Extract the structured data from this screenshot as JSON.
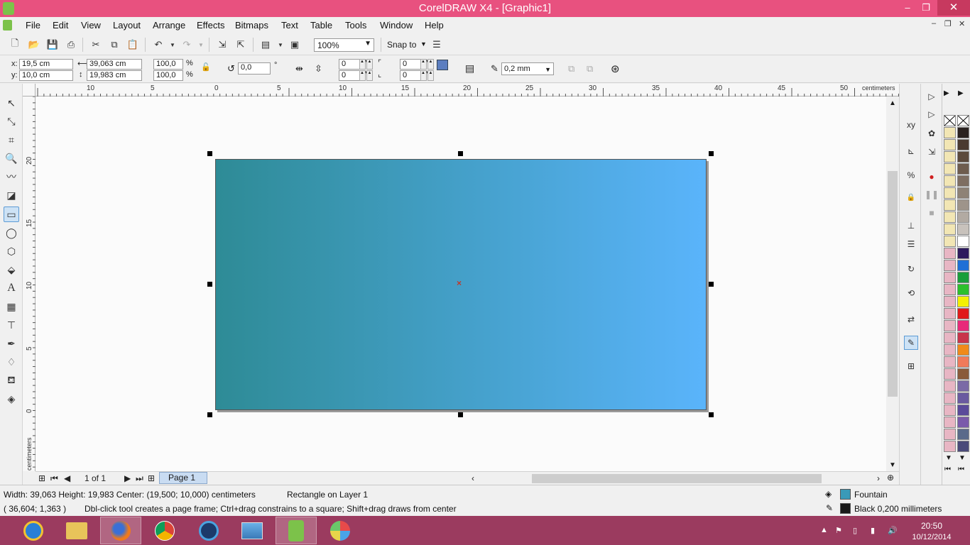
{
  "window": {
    "title": "CorelDRAW X4 - [Graphic1]",
    "minimize": "–",
    "restore": "❐",
    "close": "✕"
  },
  "menu": {
    "items": [
      "File",
      "Edit",
      "View",
      "Layout",
      "Arrange",
      "Effects",
      "Bitmaps",
      "Text",
      "Table",
      "Tools",
      "Window",
      "Help"
    ],
    "doc_controls": [
      "–",
      "❐",
      "✕"
    ]
  },
  "standard_toolbar": {
    "zoom_level": "100%",
    "snap_label": "Snap to"
  },
  "property_bar": {
    "x_label": "x:",
    "x_value": "19,5 cm",
    "y_label": "y:",
    "y_value": "10,0 cm",
    "width_value": "39,063 cm",
    "height_value": "19,983 cm",
    "scale_w": "100,0",
    "scale_h": "100,0",
    "percent": "%",
    "rotation": "0,0",
    "degree": "°",
    "corner_tl": "0",
    "corner_bl": "0",
    "corner_tr": "0",
    "corner_br": "0",
    "outline_width": "0,2 mm"
  },
  "rulers": {
    "units": "centimeters",
    "h_ticks": [
      "10",
      "5",
      "0",
      "5",
      "10",
      "15",
      "20",
      "25",
      "30",
      "35",
      "40",
      "45",
      "50"
    ],
    "v_ticks": [
      "20",
      "15",
      "10",
      "5",
      "0"
    ]
  },
  "page_nav": {
    "page_count": "1 of 1",
    "page_tab": "Page 1"
  },
  "status": {
    "dimensions": "Width: 39,063  Height: 19,983  Center: (19,500; 10,000)  centimeters",
    "object_info": "Rectangle on Layer 1",
    "cursor_pos": "( 36,604; 1,363 )",
    "hint": "Dbl-click tool creates a page frame; Ctrl+drag constrains to a square; Shift+drag draws from center",
    "fill_label": "Fountain",
    "outline_label": "Black  0,200 millimeters",
    "fill_color": "#3a9ab8",
    "outline_color": "#1a1a1a"
  },
  "shape": {
    "fill_type": "Fountain",
    "gradient_start": "#2e8b96",
    "gradient_end": "#5ab4fb"
  },
  "palette": {
    "colors": [
      "#2a2220",
      "#4a3a30",
      "#5c4a3c",
      "#6e5c4e",
      "#7e6e62",
      "#8e8276",
      "#9e948a",
      "#b2aaa2",
      "#c8c2bc",
      "#ffffff",
      "#2e1a5e",
      "#1f6fd6",
      "#1a9e3a",
      "#2cc02c",
      "#f4f000",
      "#e01a1a",
      "#e82a7a",
      "#c8344a",
      "#f08a1a",
      "#f07a5a",
      "#8a5a3a",
      "#7a6aa6",
      "#6a5aa0",
      "#5a4a9a",
      "#7a5aaa",
      "#5a6a8a",
      "#4a4a7a"
    ]
  },
  "taskbar": {
    "time": "20:50",
    "date": "10/12/2014"
  }
}
